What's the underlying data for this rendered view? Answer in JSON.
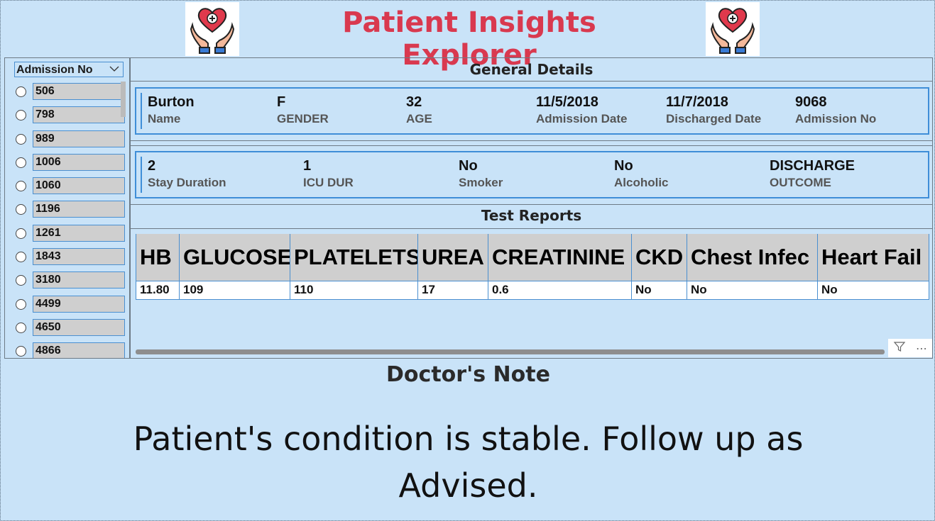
{
  "header": {
    "title": "Patient Insights Explorer",
    "logo_icon": "caring-hands-heart-icon"
  },
  "slicer": {
    "label": "Admission No",
    "items": [
      "506",
      "798",
      "989",
      "1006",
      "1060",
      "1196",
      "1261",
      "1843",
      "3180",
      "4499",
      "4650",
      "4866"
    ]
  },
  "general": {
    "title": "General Details",
    "row1": [
      {
        "value": "Burton",
        "label": "Name"
      },
      {
        "value": "F",
        "label": "GENDER"
      },
      {
        "value": "32",
        "label": "AGE"
      },
      {
        "value": "11/5/2018",
        "label": "Admission Date"
      },
      {
        "value": "11/7/2018",
        "label": "Discharged Date"
      },
      {
        "value": "9068",
        "label": "Admission No"
      }
    ],
    "row2": [
      {
        "value": "2",
        "label": "Stay Duration"
      },
      {
        "value": "1",
        "label": "ICU DUR"
      },
      {
        "value": "No",
        "label": "Smoker"
      },
      {
        "value": "No",
        "label": "Alcoholic"
      },
      {
        "value": "DISCHARGE",
        "label": "OUTCOME"
      }
    ]
  },
  "reports": {
    "title": "Test Reports",
    "columns": [
      "HB",
      "GLUCOSE",
      "PLATELETS",
      "UREA",
      "CREATININE",
      "CKD",
      "Chest Infec",
      "Heart Fail"
    ],
    "row": [
      "11.80",
      "109",
      "110",
      "17",
      "0.6",
      "No",
      "No",
      "No"
    ]
  },
  "note": {
    "title": "Doctor's Note",
    "text": "Patient's condition is stable. Follow up as Advised."
  },
  "colors": {
    "title": "#d9394f",
    "background": "#c9e3f8",
    "accent": "#3f8ed8"
  }
}
